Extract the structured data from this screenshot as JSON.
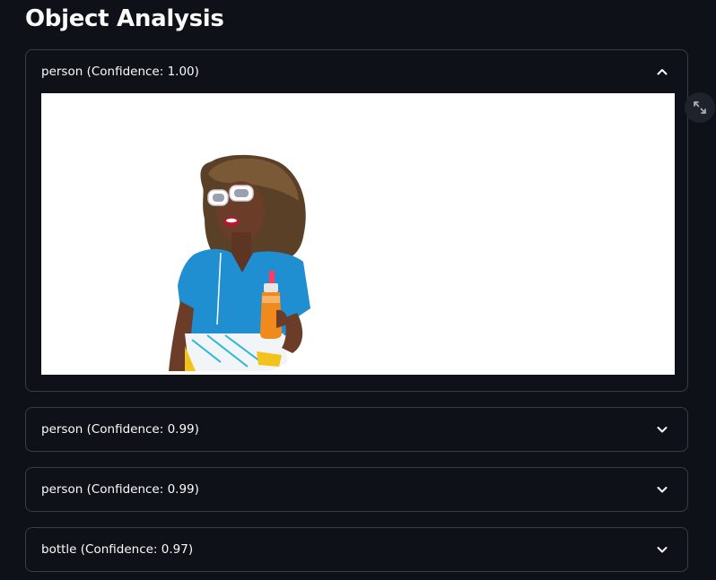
{
  "page": {
    "title": "Object Analysis"
  },
  "expanders": [
    {
      "label": "person (Confidence: 1.00)",
      "expanded": true
    },
    {
      "label": "person (Confidence: 0.99)",
      "expanded": false
    },
    {
      "label": "person (Confidence: 0.99)",
      "expanded": false
    },
    {
      "label": "bottle (Confidence: 0.97)",
      "expanded": false
    }
  ],
  "icons": {
    "expanded": "chevron-up-icon",
    "collapsed": "chevron-down-icon",
    "fullscreen": "expand-icon"
  },
  "colors": {
    "background": "#0e1117",
    "border": "#3a3d46",
    "text": "#fafafa",
    "shirt": "#1f8fd1",
    "juice": "#f08a1c"
  }
}
